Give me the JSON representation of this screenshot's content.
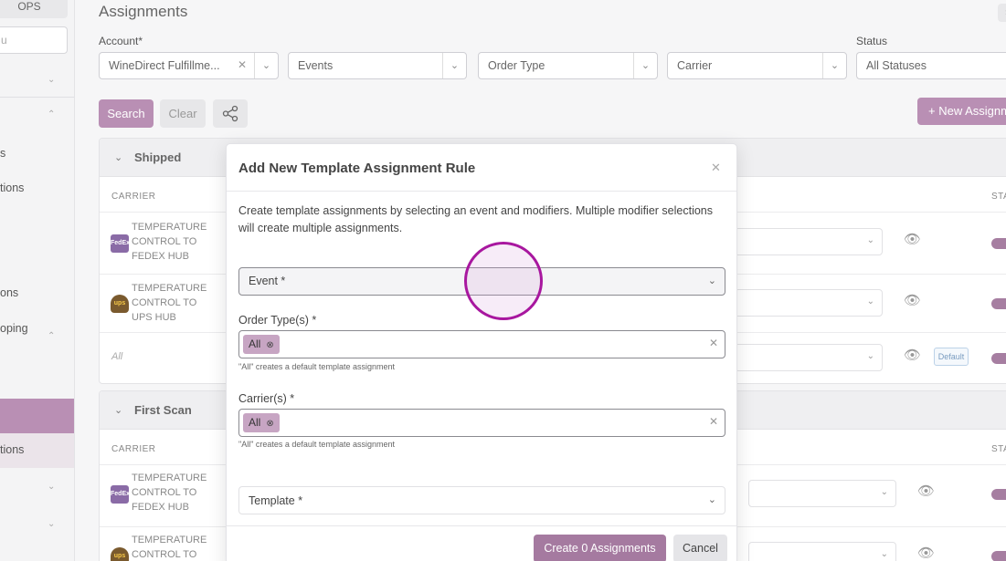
{
  "sidebar": {
    "ops": "OPS",
    "search_placeholder": "u",
    "items": [
      "s",
      "tions",
      "ons",
      "oping",
      "tions"
    ]
  },
  "header": {
    "title": "Assignments"
  },
  "filters": {
    "account_label": "Account*",
    "account_value": "WineDirect Fulfillme...",
    "events_placeholder": "Events",
    "order_type_placeholder": "Order Type",
    "carrier_placeholder": "Carrier",
    "status_label": "Status",
    "status_value": "All Statuses"
  },
  "toolbar": {
    "search_label": "Search",
    "clear_label": "Clear",
    "new_label": "+ New Assignm"
  },
  "sections": [
    {
      "title": "Shipped",
      "col_carrier": "CARRIER",
      "col_status": "STA",
      "rows": [
        {
          "logo": "FedEx",
          "name": "TEMPERATURE CONTROL TO FEDEX HUB"
        },
        {
          "logo": "ups",
          "name": "TEMPERATURE CONTROL TO UPS HUB"
        },
        {
          "name": "All",
          "badge": "Default"
        }
      ]
    },
    {
      "title": "First Scan",
      "col_carrier": "CARRIER",
      "col_status": "STA",
      "rows": [
        {
          "logo": "FedEx",
          "name": "TEMPERATURE CONTROL TO FEDEX HUB"
        },
        {
          "logo": "ups",
          "name": "TEMPERATURE CONTROL TO UPS"
        }
      ]
    }
  ],
  "modal": {
    "title": "Add New Template Assignment Rule",
    "description": "Create template assignments by selecting an event and modifiers. Multiple modifier selections will create multiple assignments.",
    "event_placeholder": "Event *",
    "order_types_label": "Order Type(s) *",
    "order_types_tag": "All",
    "order_types_help": "\"All\" creates a default template assignment",
    "carriers_label": "Carrier(s) *",
    "carriers_tag": "All",
    "carriers_help": "\"All\" creates a default template assignment",
    "template_placeholder": "Template *",
    "create_label": "Create 0 Assignments",
    "cancel_label": "Cancel"
  },
  "colors": {
    "accent": "#b98fb4",
    "accent_dark": "#a57aa0",
    "cursor": "#a8179f"
  },
  "icons": [
    "share-icon",
    "close-icon",
    "chevron-down-icon",
    "eye-icon",
    "tag-remove-icon",
    "fedex-logo",
    "ups-logo"
  ]
}
